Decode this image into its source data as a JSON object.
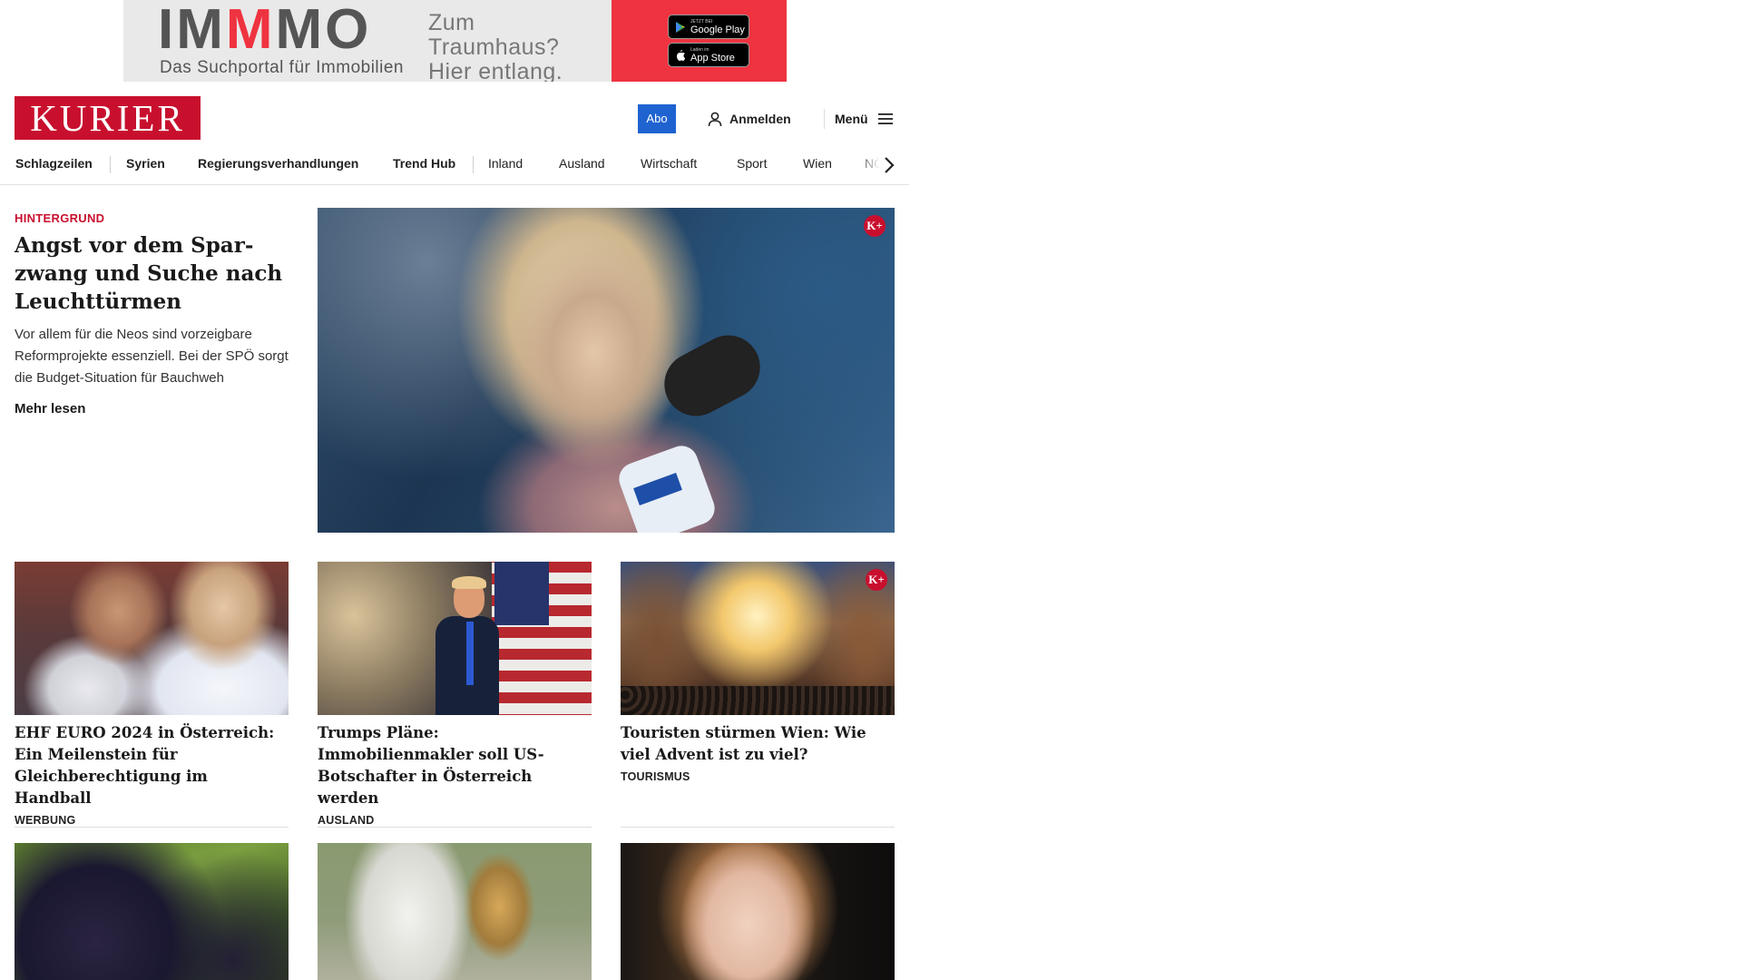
{
  "ad": {
    "brand": "IMMMO",
    "brand_pre": "IM",
    "brand_mid": "M",
    "brand_post": "MO",
    "tagline": "Das Suchportal für Immobilien",
    "slogan_line1": "Zum Traumhaus?",
    "slogan_line2": "Hier entlang.",
    "google_play_top": "JETZT BEI",
    "google_play": "Google Play",
    "app_store_top": "Laden im",
    "app_store": "App Store",
    "accent_color": "#ef3340"
  },
  "header": {
    "logo": "KURIER",
    "abo": "Abo",
    "login": "Anmelden",
    "menu": "Menü",
    "brand_color": "#c8102e",
    "abo_color": "#1f63d1"
  },
  "nav": {
    "items": [
      "Schlagzeilen",
      "Syrien",
      "Regierungsverhandlungen",
      "Trend Hub",
      "Inland",
      "Ausland",
      "Wirtschaft",
      "Sport",
      "Wien",
      "NÖ"
    ]
  },
  "lead": {
    "kicker": "HINTERGRUND",
    "title": "Angst vor dem Spar­zwang und Suche nach Leuchttürmen",
    "teaser": "Vor allem für die Neos sind vorzeigbare Reformprojekte essenziell. Bei der SPÖ sorgt die Budget-Situation für Bauchweh",
    "more": "Mehr lesen",
    "premium_badge": "K+"
  },
  "cards": [
    {
      "title": "EHF EURO 2024 in Österreich: Ein Meilenstein für Gleichberechti­gung im Handball",
      "category": "WERBUNG"
    },
    {
      "title": "Trumps Pläne: Immobilienmakler soll US-Botschafter in Österreich werden",
      "category": "AUSLAND"
    },
    {
      "title": "Touristen stürmen Wien: Wie viel Advent ist zu viel?",
      "category": "TOURISMUS",
      "premium_badge": "K+"
    }
  ]
}
